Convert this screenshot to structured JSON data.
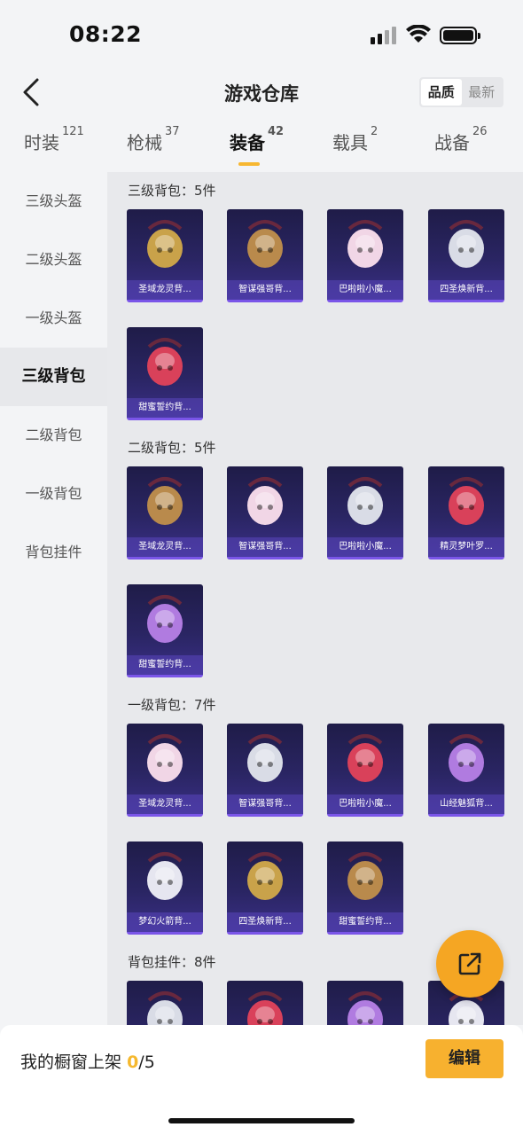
{
  "status": {
    "time": "08:22"
  },
  "header": {
    "title": "游戏仓库",
    "sort": [
      "品质",
      "最新"
    ]
  },
  "tabs": [
    {
      "label": "时装",
      "count": "121"
    },
    {
      "label": "枪械",
      "count": "37"
    },
    {
      "label": "装备",
      "count": "42"
    },
    {
      "label": "载具",
      "count": "2"
    },
    {
      "label": "战备",
      "count": "26"
    }
  ],
  "sidebar": [
    "三级头盔",
    "二级头盔",
    "一级头盔",
    "三级背包",
    "二级背包",
    "一级背包",
    "背包挂件"
  ],
  "sections": [
    {
      "title": "三级背包：5件",
      "items": [
        "圣域龙灵背...",
        "智谋强哥背...",
        "巴啦啦小魔...",
        "四圣焕新背...",
        "甜蜜誓约背..."
      ]
    },
    {
      "title": "二级背包：5件",
      "items": [
        "圣域龙灵背...",
        "智谋强哥背...",
        "巴啦啦小魔...",
        "精灵梦叶罗...",
        "甜蜜誓约背..."
      ]
    },
    {
      "title": "一级背包：7件",
      "items": [
        "圣域龙灵背...",
        "智谋强哥背...",
        "巴啦啦小魔...",
        "山经魅狐背...",
        "梦幻火箭背...",
        "四圣焕新背...",
        "甜蜜誓约背..."
      ]
    },
    {
      "title": "背包挂件：8件",
      "items": [
        "",
        "",
        "",
        ""
      ]
    }
  ],
  "bottom": {
    "shelf_label": "我的橱窗上架",
    "shelf_current": "0",
    "shelf_total": "/5",
    "edit": "编辑"
  },
  "colors": {
    "accent": "#f7b12f",
    "card_bg": "#2a2563",
    "card_border": "#7a55e8"
  },
  "icons": [
    "back-icon",
    "share-icon",
    "signal-icon",
    "wifi-icon",
    "battery-icon"
  ]
}
